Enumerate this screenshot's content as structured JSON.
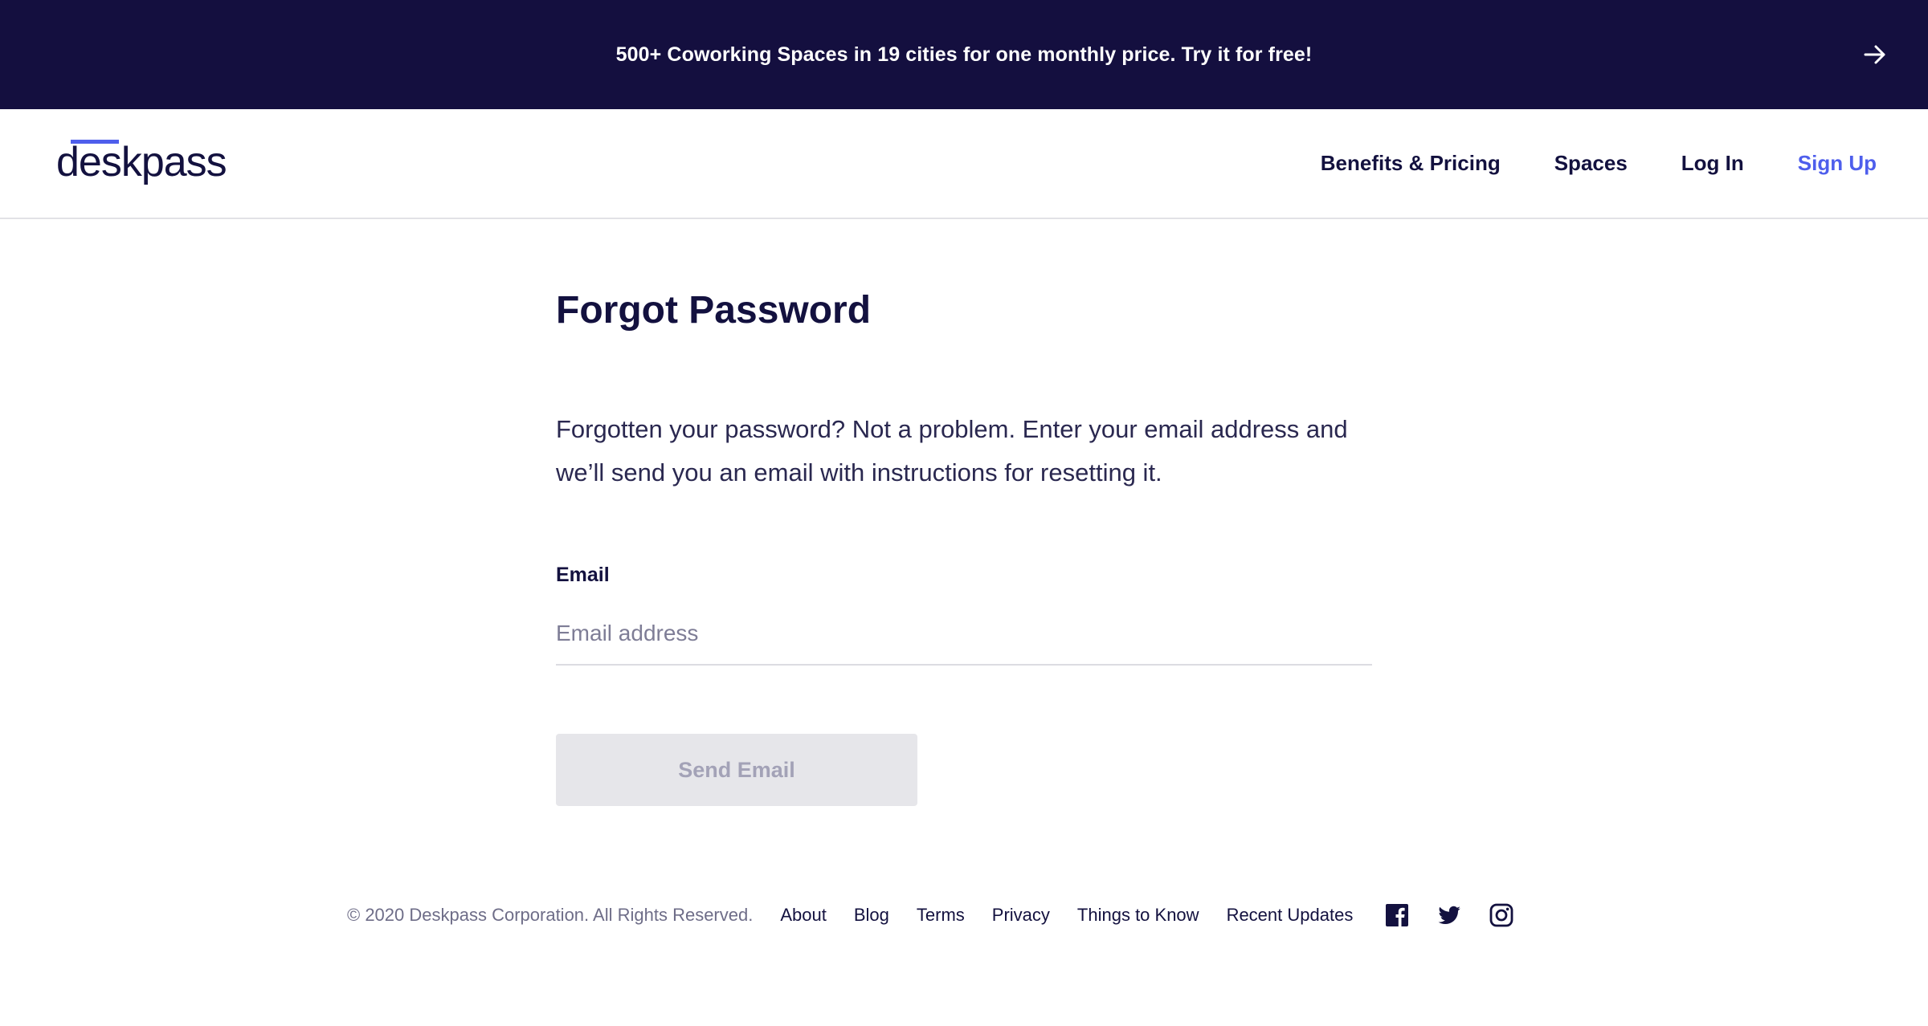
{
  "promo": {
    "text": "500+ Coworking Spaces in 19 cities for one monthly price. Try it for free!",
    "icon": "arrow-right-icon"
  },
  "header": {
    "logo": "deskpass",
    "nav": {
      "benefits": "Benefits & Pricing",
      "spaces": "Spaces",
      "login": "Log In",
      "signup": "Sign Up"
    }
  },
  "main": {
    "title": "Forgot Password",
    "intro": "Forgotten your password? Not a problem. Enter your email address and we’ll send you an email with instructions for resetting it.",
    "email_label": "Email",
    "email_value": "",
    "email_placeholder": "Email address",
    "send_label": "Send Email"
  },
  "footer": {
    "copyright": "© 2020 Deskpass Corporation. All Rights Reserved.",
    "links": {
      "about": "About",
      "blog": "Blog",
      "terms": "Terms",
      "privacy": "Privacy",
      "things": "Things to Know",
      "updates": "Recent Updates"
    },
    "social": [
      "facebook-icon",
      "twitter-icon",
      "instagram-icon"
    ]
  },
  "colors": {
    "navy": "#140f3f",
    "accent": "#4e5eec",
    "text": "#13113f",
    "disabled_bg": "#e6e6ea",
    "disabled_text": "#a3a2b7"
  }
}
